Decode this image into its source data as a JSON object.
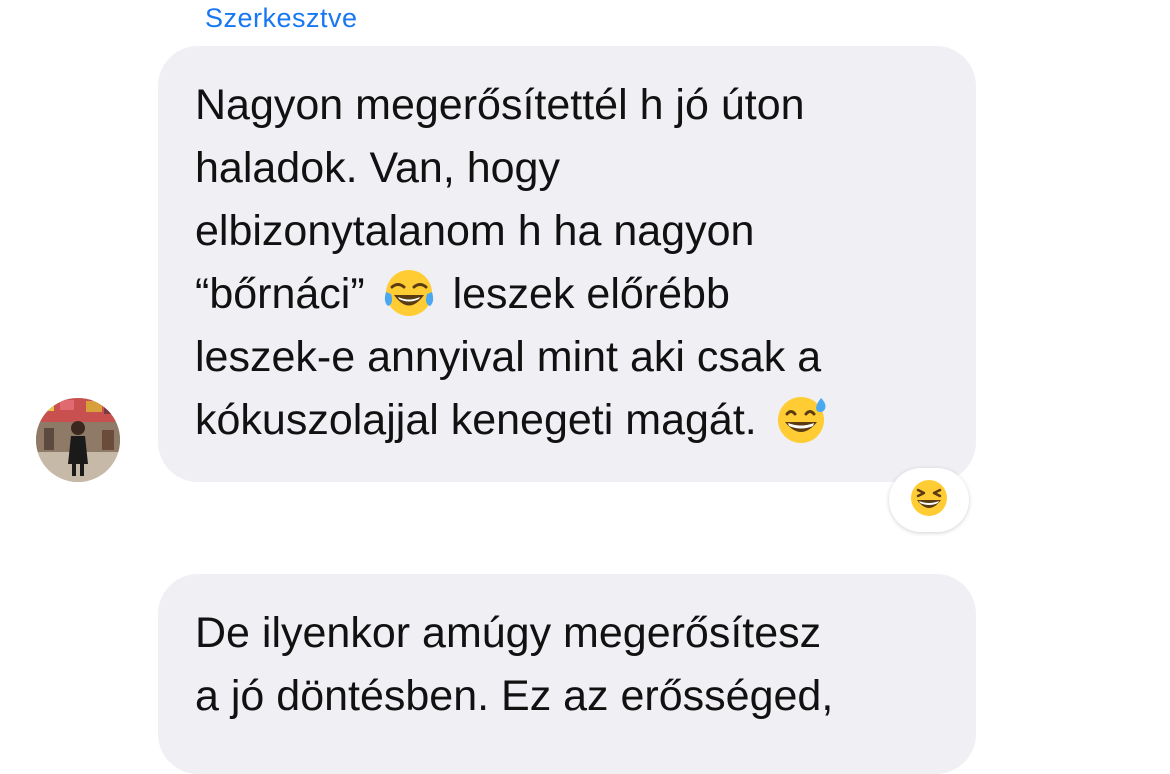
{
  "header": {
    "edited_label": "Szerkesztve"
  },
  "messages": [
    {
      "lines": [
        "Nagyon megerősítettél h jó úton",
        "haladok. Van, hogy",
        "elbizonytalanom h ha nagyon",
        "“bőrnáci”",
        "leszek előrébb",
        "leszek-e annyival mint aki csak a",
        "kókuszolajjal kenegeti magát."
      ],
      "inline_emojis": [
        "face-with-tears-of-joy",
        "grinning-face-with-sweat"
      ],
      "reaction": "grinning-squinting-face"
    },
    {
      "lines": [
        "De ilyenkor amúgy megerősítesz",
        "a jó döntésben. Ez az erősséged,"
      ]
    }
  ],
  "colors": {
    "accent_link": "#1877f2",
    "bubble_background": "#efeff4",
    "message_text": "#111111",
    "emoji_yellow": "#ffcc33"
  }
}
